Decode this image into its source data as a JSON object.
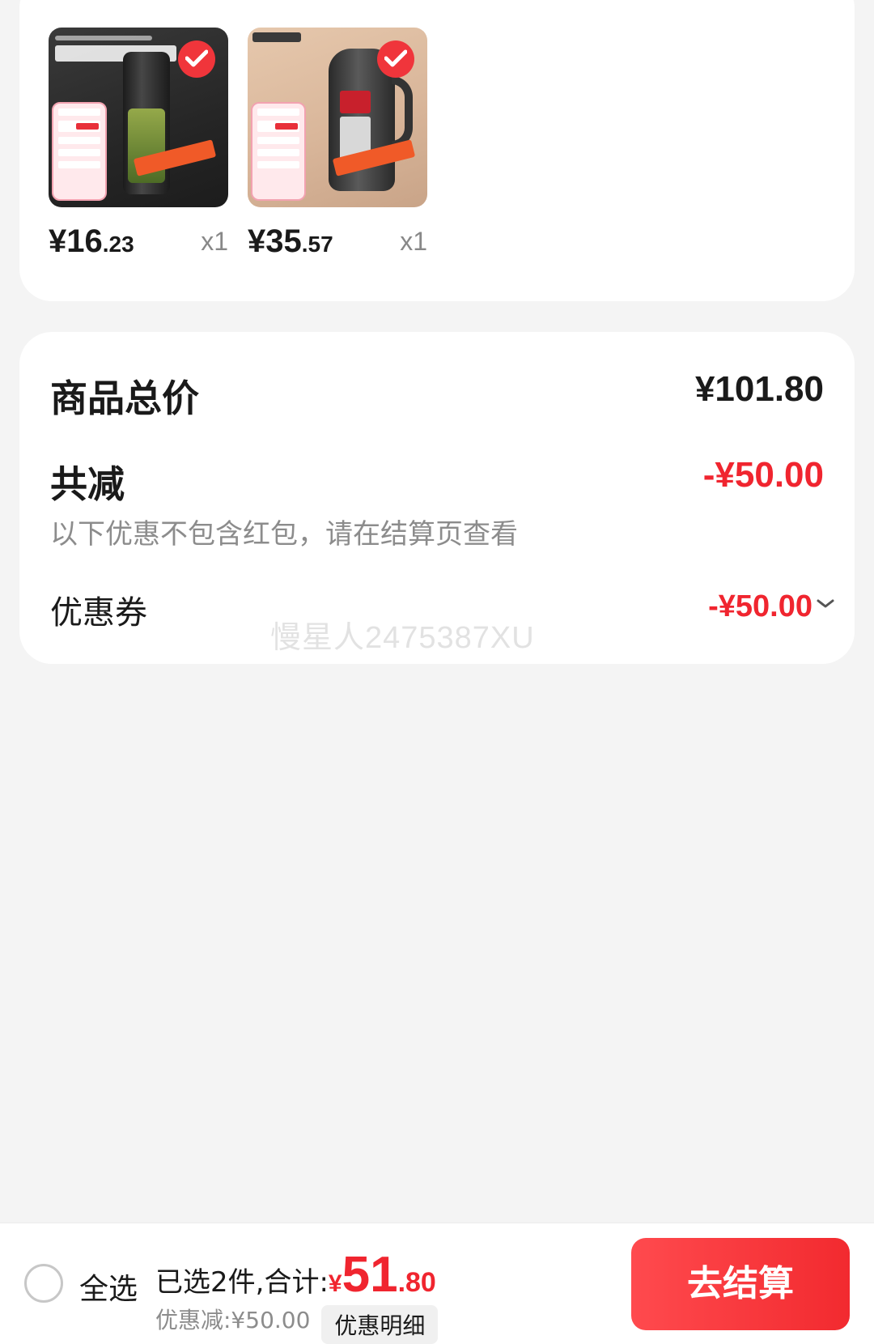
{
  "products": [
    {
      "price_yen": "¥",
      "price_int": "16",
      "price_dec": ".23",
      "qty": "x1",
      "selected": true
    },
    {
      "price_yen": "¥",
      "price_int": "35",
      "price_dec": ".57",
      "qty": "x1",
      "selected": true
    }
  ],
  "summary": {
    "total_label": "商品总价",
    "total_value": "¥101.80",
    "reduce_label": "共减",
    "reduce_value": "-¥50.00",
    "note": "以下优惠不包含红包，请在结算页查看",
    "coupon_label": "优惠券",
    "coupon_value": "-¥50.00"
  },
  "watermark": "慢星人2475387XU",
  "bottom_bar": {
    "select_all": "全选",
    "selected_text": "已选2件,合计:",
    "total_yen": "¥",
    "total_int": "51",
    "total_dec": ".80",
    "discount_text": "优惠减:¥50.00",
    "detail_button": "优惠明细",
    "checkout_button": "去结算"
  },
  "colors": {
    "accent_red": "#f0252f",
    "background": "#f4f4f4"
  }
}
